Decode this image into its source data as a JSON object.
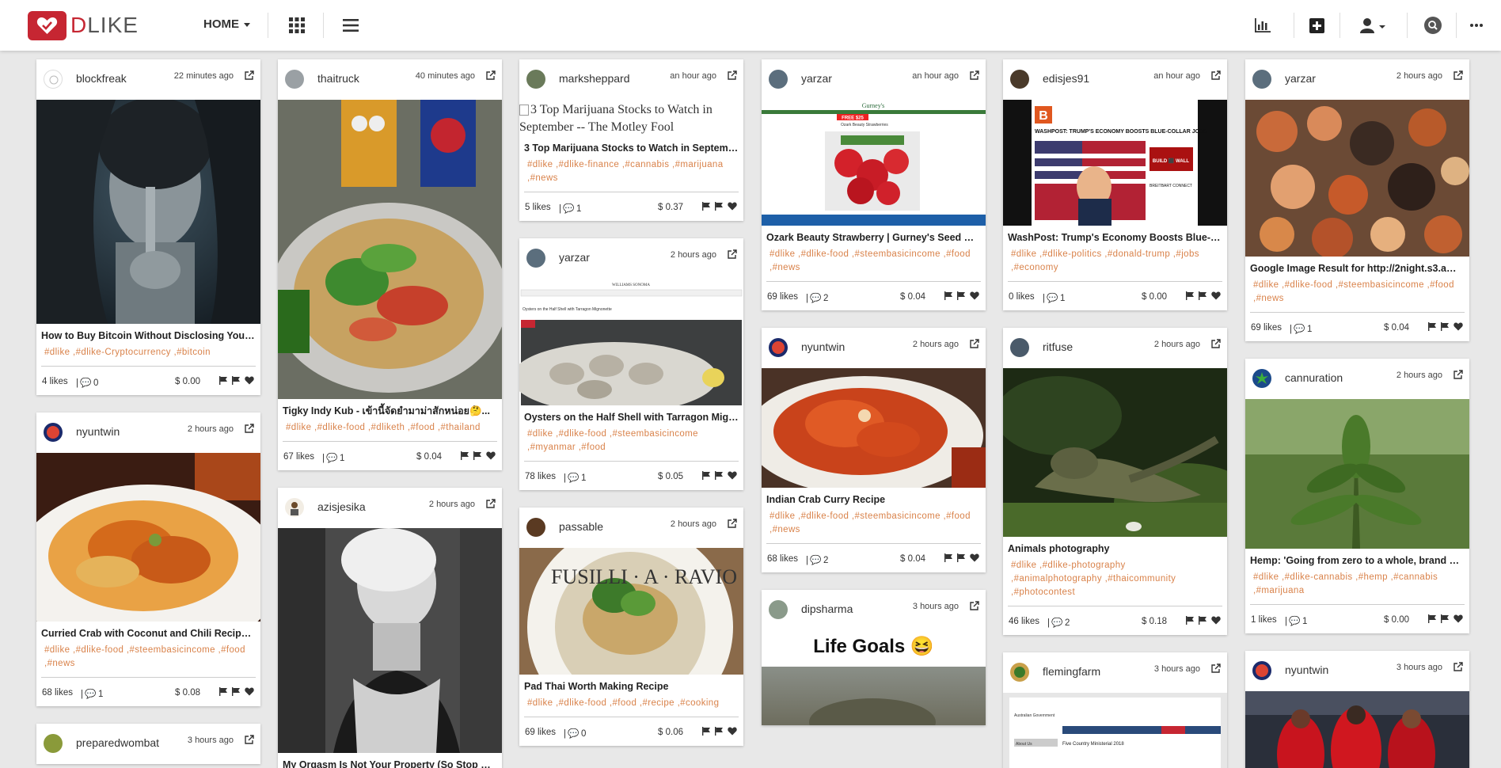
{
  "brand": {
    "name_prefix": "D",
    "name_rest": "LIKE",
    "accent": "#c62632"
  },
  "nav": {
    "home_label": "HOME"
  },
  "columns": [
    [
      {
        "author": "blockfreak",
        "time": "22 minutes ago",
        "title": "How to Buy Bitcoin Without Disclosing Your I...",
        "tags": "#dlike ,#dlike-Cryptocurrency ,#bitcoin",
        "likes": "4 likes",
        "comments": "0",
        "payout": "$ 0.00",
        "image": "woman-portrait"
      },
      {
        "author": "nyuntwin",
        "time": "2 hours ago",
        "title": "Curried Crab with Coconut and Chili Recipe | ...",
        "tags": "#dlike ,#dlike-food ,#steembasicincome ,#food ,#news",
        "likes": "68 likes",
        "comments": "1",
        "payout": "$ 0.08",
        "image": "curried-crab"
      },
      {
        "author": "preparedwombat",
        "time": "3 hours ago"
      }
    ],
    [
      {
        "author": "thaitruck",
        "time": "40 minutes ago",
        "title": "Tigky Indy Kub - เข้านี้จัดยำมาม่าสักหน่อย🤔...",
        "tags": "#dlike ,#dlike-food ,#dliketh ,#food ,#thailand",
        "likes": "67 likes",
        "comments": "1",
        "payout": "$ 0.04",
        "image": "noodle-salad"
      },
      {
        "author": "azisjesika",
        "time": "2 hours ago",
        "title": "My Orgasm Is Not Your Property (So Stop Say...",
        "image": "bw-woman"
      }
    ],
    [
      {
        "author": "marksheppard",
        "time": "an hour ago",
        "broken_alt": "3 Top Marijuana Stocks to Watch in September -- The Motley Fool",
        "title": "3 Top Marijuana Stocks to Watch in Septemb...",
        "tags": "#dlike ,#dlike-finance ,#cannabis ,#marijuana ,#news",
        "likes": "5 likes",
        "comments": "1",
        "payout": "$ 0.37",
        "image": "none"
      },
      {
        "author": "yarzar",
        "time": "2 hours ago",
        "title": "Oysters on the Half Shell with Tarragon Mign...",
        "tags": "#dlike ,#dlike-food ,#steembasicincome ,#myanmar ,#food",
        "likes": "78 likes",
        "comments": "1",
        "payout": "$ 0.05",
        "image": "oysters"
      },
      {
        "author": "passable",
        "time": "2 hours ago",
        "title": "Pad Thai Worth Making Recipe",
        "tags": "#dlike ,#dlike-food ,#food ,#recipe ,#cooking",
        "likes": "69 likes",
        "comments": "0",
        "payout": "$ 0.06",
        "image": "pad-thai"
      }
    ],
    [
      {
        "author": "yarzar",
        "time": "an hour ago",
        "title": "Ozark Beauty Strawberry | Gurney's Seed & N...",
        "tags": "#dlike ,#dlike-food ,#steembasicincome ,#food ,#news",
        "likes": "69 likes",
        "comments": "2",
        "payout": "$ 0.04",
        "image": "strawberry-site"
      },
      {
        "author": "nyuntwin",
        "time": "2 hours ago",
        "title": "Indian Crab Curry Recipe",
        "tags": "#dlike ,#dlike-food ,#steembasicincome ,#food ,#news",
        "likes": "68 likes",
        "comments": "2",
        "payout": "$ 0.04",
        "image": "crab-curry"
      },
      {
        "author": "dipsharma",
        "time": "3 hours ago",
        "banner": "Life Goals 😆",
        "image": "life-goals"
      }
    ],
    [
      {
        "author": "edisjes91",
        "time": "an hour ago",
        "title": "WashPost: Trump's Economy Boosts Blue-Col...",
        "tags": "#dlike ,#dlike-politics ,#donald-trump ,#jobs ,#economy",
        "likes": "0 likes",
        "comments": "1",
        "payout": "$ 0.00",
        "image": "breitbart-site"
      },
      {
        "author": "ritfuse",
        "time": "2 hours ago",
        "title": "Animals photography",
        "tags": "#dlike ,#dlike-photography ,#animalphotography ,#thaicommunity ,#photocontest",
        "likes": "46 likes",
        "comments": "2",
        "payout": "$ 0.18",
        "image": "lizard"
      },
      {
        "author": "flemingfarm",
        "time": "3 hours ago",
        "image": "gov-site"
      }
    ],
    [
      {
        "author": "yarzar",
        "time": "2 hours ago",
        "title": "Google Image Result for http://2night.s3.ama...",
        "tags": "#dlike ,#dlike-food ,#steembasicincome ,#food ,#news",
        "likes": "69 likes",
        "comments": "1",
        "payout": "$ 0.04",
        "image": "seafood"
      },
      {
        "author": "cannuration",
        "time": "2 hours ago",
        "title": "Hemp: 'Going from zero to a whole, brand ne...",
        "tags": "#dlike ,#dlike-cannabis ,#hemp ,#cannabis ,#marijuana",
        "likes": "1 likes",
        "comments": "1",
        "payout": "$ 0.00",
        "image": "hemp"
      },
      {
        "author": "nyuntwin",
        "time": "3 hours ago",
        "image": "football"
      }
    ]
  ],
  "gov_site_text": {
    "line1": "Australian Government",
    "line2": "Five Country Ministerial 2018",
    "line3": "About Us"
  },
  "site_text": {
    "strawberry_brand": "Gurney's",
    "strawberry_promo": "FREE $25",
    "strawberry_caption": "Ozark Beauty Strawberries",
    "breitbart_logo": "B",
    "breitbart_headline": "WASHPOST: TRUMP'S ECONOMY BOOSTS BLUE-COLLAR JOBS",
    "breitbart_build": "BUILD ⬛ WALL",
    "breitbart_connect": "BREITBART CONNECT",
    "oysters_site": "WILLIAMS SONOMA",
    "oysters_caption": "Oysters on the Half Shell with Tarragon Mignonette",
    "plate_text": "FUSILLI · A · RAVIO"
  }
}
